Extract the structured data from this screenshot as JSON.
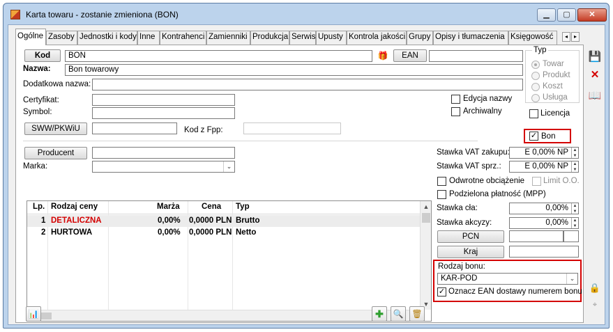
{
  "window": {
    "title": "Karta towaru - zostanie zmieniona (BON)",
    "minimize": "▁",
    "maximize": "▢",
    "close": "✕"
  },
  "tabs": [
    "Ogólne",
    "Zasoby",
    "Jednostki i kody",
    "Inne",
    "Kontrahenci",
    "Zamienniki",
    "Produkcja",
    "Serwis",
    "Upusty",
    "Kontrola jakości",
    "Grupy",
    "Opisy i tłumaczenia",
    "Księgowość"
  ],
  "tab_scroll": {
    "left": "◂",
    "right": "▸"
  },
  "form": {
    "kod_button": "Kod",
    "kod_value": "BON",
    "ean_button": "EAN",
    "ean_value": "",
    "nazwa_label": "Nazwa:",
    "nazwa_value": "Bon towarowy",
    "dodatkowa_label": "Dodatkowa nazwa:",
    "dodatkowa_value": "",
    "certyfikat_label": "Certyfikat:",
    "certyfikat_value": "",
    "symbol_label": "Symbol:",
    "symbol_value": "",
    "sww_button": "SWW/PKWiU",
    "sww_value": "",
    "kodfpp_label": "Kod z Fpp:",
    "kodfpp_value": "",
    "edycja_nazwy_label": "Edycja nazwy",
    "archiwalny_label": "Archiwalny",
    "producent_button": "Producent",
    "producent_value": "",
    "marka_label": "Marka:",
    "marka_value": ""
  },
  "typ": {
    "label": "Typ",
    "options": [
      "Towar",
      "Produkt",
      "Koszt",
      "Usługa"
    ],
    "selected": "Towar"
  },
  "checkboxes": {
    "licencja": "Licencja",
    "bon": "Bon",
    "odwrotne": "Odwrotne obciążenie",
    "limit": "Limit O.O.",
    "podzielona": "Podzielona płatność (MPP)"
  },
  "vat": {
    "zakupu_label": "Stawka VAT zakupu:",
    "zakupu_value": "E 0,00% NP",
    "sprz_label": "Stawka VAT sprz.:",
    "sprz_value": "E 0,00% NP",
    "cla_label": "Stawka cła:",
    "cla_value": "0,00%",
    "akcyzy_label": "Stawka akcyzy:",
    "akcyzy_value": "0,00%",
    "pcn_button": "PCN",
    "kraj_button": "Kraj"
  },
  "bon": {
    "rodzaj_label": "Rodzaj bonu:",
    "rodzaj_value": "KAR-POD",
    "oznacz_label": "Oznacz EAN dostawy numerem bonu"
  },
  "prices": {
    "columns": [
      "Lp.",
      "Rodzaj ceny",
      "Marża",
      "Cena",
      "Typ"
    ],
    "rows": [
      {
        "lp": "1",
        "rodzaj": "DETALICZNA",
        "marza": "0,00%",
        "cena": "0,0000 PLN",
        "typ": "Brutto",
        "highlight": "#d40000"
      },
      {
        "lp": "2",
        "rodzaj": "HURTOWA",
        "marza": "0,00%",
        "cena": "0,0000 PLN",
        "typ": "Netto",
        "highlight": "#000000"
      }
    ]
  },
  "icons": {
    "save": "💾",
    "cancel": "✕",
    "book": "📖",
    "add": "✚",
    "search": "🔍",
    "delete": "🗑",
    "report": "📊",
    "lock": "🔒"
  },
  "colors": {
    "accent_red": "#d40000",
    "add_green": "#2f9e2f",
    "save_blue": "#2d6fc0"
  }
}
